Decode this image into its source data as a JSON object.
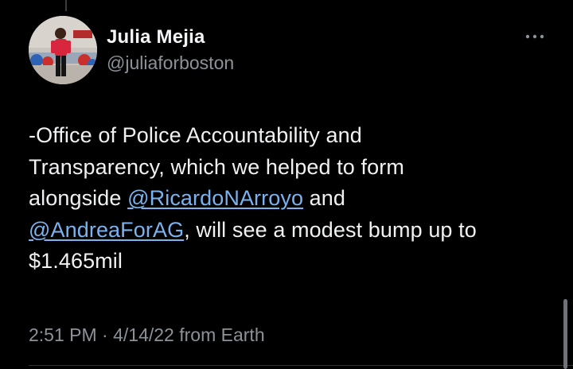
{
  "tweet": {
    "author": {
      "display_name": "Julia Mejia",
      "handle": "@juliaforboston"
    },
    "text_lines": {
      "line1": "-Office of Police Accountability and",
      "line2": "Transparency, which we helped to form",
      "line3_prefix": "alongside ",
      "line3_mention": "@RicardoNArroyo",
      "line3_suffix": " and",
      "line4_mention": "@AndreaForAG",
      "line4_suffix": ", will see a modest bump up to",
      "line5": "$1.465mil"
    },
    "time": "2:51 PM",
    "separator": " · ",
    "date": "4/14/22",
    "source": " from Earth"
  },
  "icons": {
    "more": "more-options-icon",
    "avatar": "profile-photo"
  },
  "colors": {
    "background": "#000000",
    "text": "#eff1f2",
    "secondary_text": "#8b9298",
    "mention": "#7ab3f0"
  }
}
